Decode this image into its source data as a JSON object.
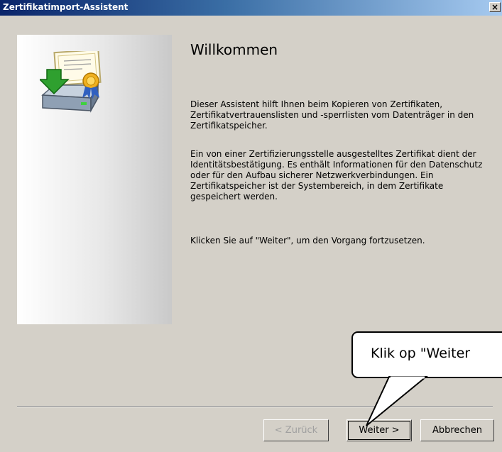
{
  "window": {
    "title": "Zertifikatimport-Assistent",
    "close_glyph": "×"
  },
  "main": {
    "heading": "Willkommen",
    "paragraph1": "Dieser Assistent hilft Ihnen beim Kopieren von Zertifikaten, Zertifikatvertrauenslisten und -sperrlisten vom Datenträger in den Zertifikatspeicher.",
    "paragraph2": "Ein von einer Zertifizierungsstelle ausgestelltes Zertifikat dient der Identitätsbestätigung. Es enthält Informationen für den Datenschutz oder für den Aufbau sicherer Netzwerkverbindungen. Ein Zertifikatspeicher ist der Systembereich, in dem Zertifikate gespeichert werden.",
    "paragraph3": "Klicken Sie auf \"Weiter\", um den Vorgang fortzusetzen."
  },
  "buttons": {
    "back": "< Zurück",
    "next": "Weiter >",
    "cancel": "Abbrechen"
  },
  "callout": {
    "text": "Klik op \"Weiter"
  },
  "icons": {
    "wizard": "certificate-import-icon"
  }
}
